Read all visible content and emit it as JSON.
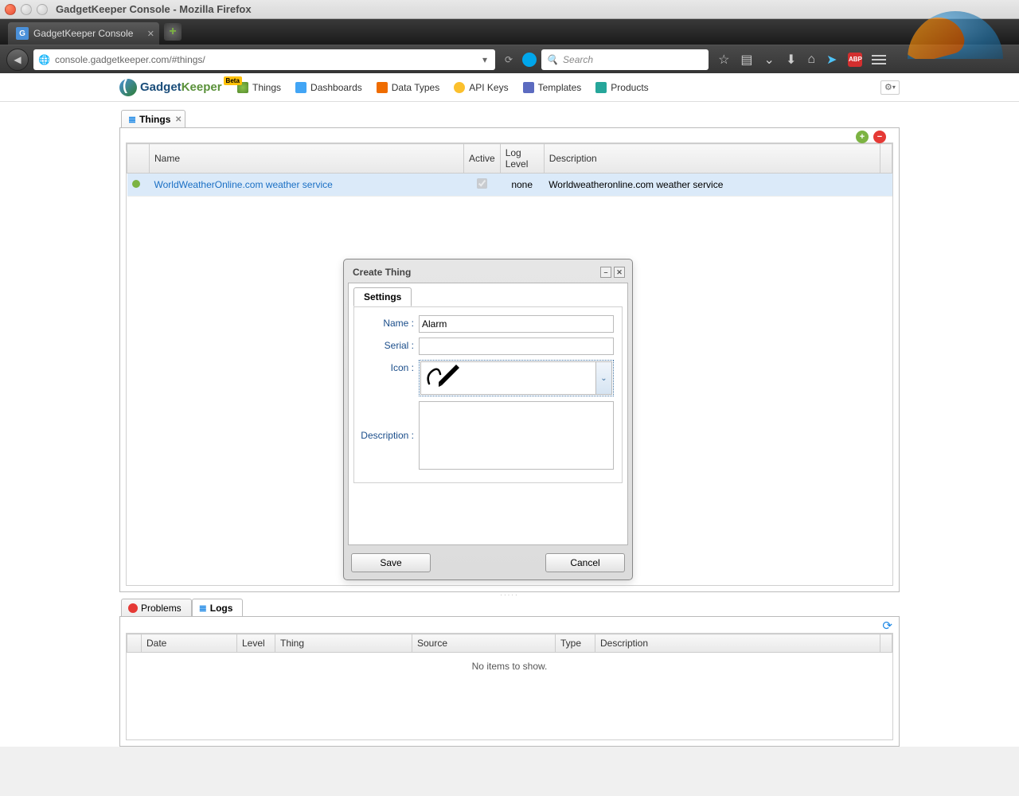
{
  "os": {
    "title": "GadgetKeeper Console - Mozilla Firefox"
  },
  "browser": {
    "tab_label": "GadgetKeeper Console",
    "url": "console.gadgetkeeper.com/#things/",
    "search_placeholder": "Search"
  },
  "app": {
    "logo_a": "Gadget",
    "logo_b": "Keeper",
    "logo_badge": "Beta",
    "menu": {
      "things": "Things",
      "dashboards": "Dashboards",
      "datatypes": "Data Types",
      "apikeys": "API Keys",
      "templates": "Templates",
      "products": "Products"
    }
  },
  "things_panel": {
    "tab": "Things",
    "columns": {
      "name": "Name",
      "active": "Active",
      "loglevel": "Log Level",
      "description": "Description"
    },
    "rows": [
      {
        "name": "WorldWeatherOnline.com weather service",
        "active": true,
        "loglevel": "none",
        "description": "Worldweatheronline.com weather service"
      }
    ]
  },
  "dialog": {
    "title": "Create Thing",
    "settings_tab": "Settings",
    "labels": {
      "name": "Name :",
      "serial": "Serial :",
      "icon": "Icon :",
      "description": "Description :"
    },
    "values": {
      "name": "Alarm",
      "serial": "",
      "description": ""
    },
    "buttons": {
      "save": "Save",
      "cancel": "Cancel"
    }
  },
  "bottom": {
    "problems": "Problems",
    "logs": "Logs",
    "columns": {
      "date": "Date",
      "level": "Level",
      "thing": "Thing",
      "source": "Source",
      "type": "Type",
      "description": "Description"
    },
    "empty": "No items to show."
  }
}
